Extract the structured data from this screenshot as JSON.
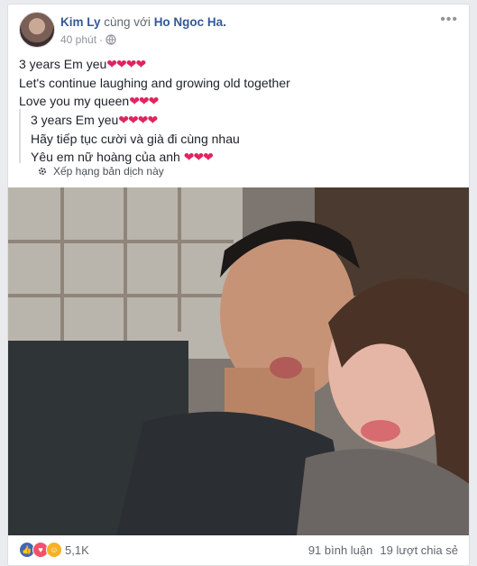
{
  "post": {
    "author": "Kim Ly",
    "with_text": "cùng với",
    "tagged": "Ho Ngoc Ha.",
    "time": "40 phút",
    "separator": "·",
    "text_lines": [
      "3 years Em yeu",
      "Let's continue laughing and growing old together",
      "Love you my queen"
    ],
    "hearts": [
      "❤❤❤❤",
      "",
      "❤❤❤"
    ]
  },
  "translation": {
    "lines": [
      "3 years Em yeu",
      "Hãy tiếp tục cười và già đi cùng nhau",
      "Yêu em nữ hoàng của anh "
    ],
    "hearts": [
      "❤❤❤❤",
      "",
      "❤❤❤"
    ],
    "rate_label": "Xếp hạng bản dịch này"
  },
  "reactions": {
    "count": "5,1K",
    "icons": [
      "like-icon",
      "love-icon",
      "haha-icon"
    ],
    "colors": {
      "like": "#4267b2",
      "love": "#f25268",
      "haha": "#f7b125"
    }
  },
  "stats": {
    "comments": "91 bình luận",
    "shares": "19 lượt chia sẻ"
  },
  "colors": {
    "link": "#365899",
    "meta": "#90949c",
    "text": "#1d2129"
  }
}
